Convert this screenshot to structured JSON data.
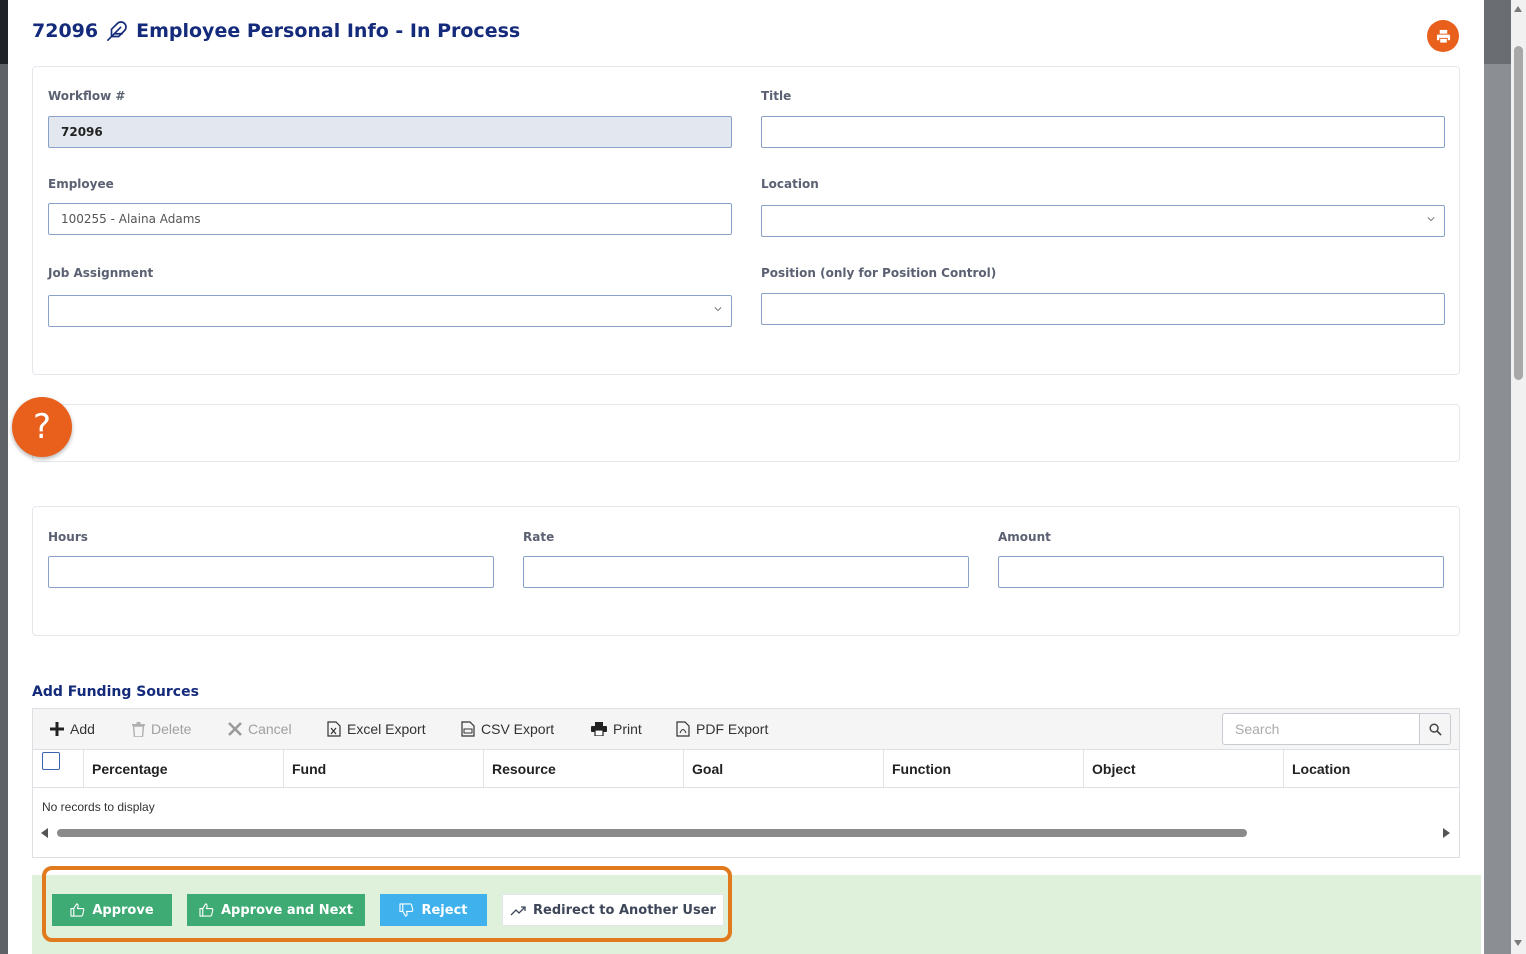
{
  "header": {
    "workflow_no": "72096",
    "title": "Employee Personal Info - In Process"
  },
  "form": {
    "workflow_label": "Workflow #",
    "workflow_value": "72096",
    "title_label": "Title",
    "title_value": "",
    "employee_label": "Employee",
    "employee_value": "100255 - Alaina Adams",
    "location_label": "Location",
    "location_value": "",
    "job_assignment_label": "Job Assignment",
    "job_assignment_value": "",
    "position_label": "Position (only for Position Control)",
    "position_value": ""
  },
  "help": {
    "label": "?"
  },
  "pay": {
    "hours_label": "Hours",
    "hours_value": "",
    "rate_label": "Rate",
    "rate_value": "",
    "amount_label": "Amount",
    "amount_value": ""
  },
  "funding": {
    "section_title": "Add Funding Sources",
    "toolbar": {
      "add": "Add",
      "delete": "Delete",
      "cancel": "Cancel",
      "excel": "Excel Export",
      "csv": "CSV Export",
      "print": "Print",
      "pdf": "PDF Export",
      "search_placeholder": "Search"
    },
    "columns": [
      "Percentage",
      "Fund",
      "Resource",
      "Goal",
      "Function",
      "Object",
      "Location"
    ],
    "empty_text": "No records to display"
  },
  "actions": {
    "approve": "Approve",
    "approve_next": "Approve and Next",
    "reject": "Reject",
    "redirect": "Redirect to Another User"
  },
  "colors": {
    "title_navy": "#142a7a",
    "accent_orange": "#e8601c",
    "approve_green": "#3dab73",
    "reject_blue": "#3fb1ec",
    "action_bar_bg": "#dff0db",
    "highlight_orange": "#e07a1d"
  }
}
